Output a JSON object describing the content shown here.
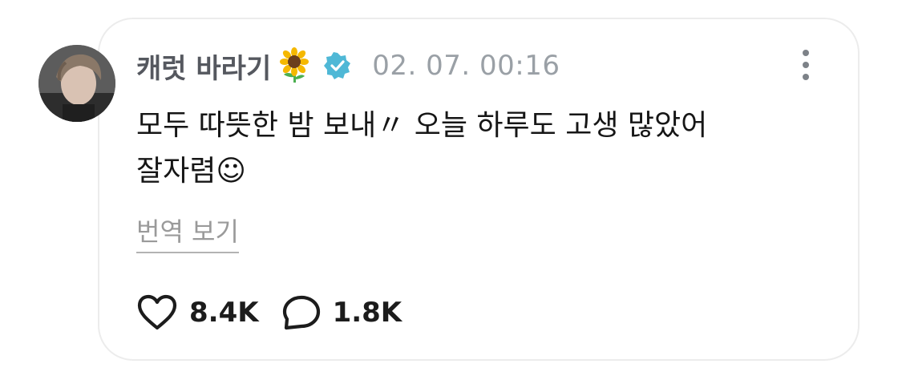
{
  "post": {
    "author_name": "캐럿 바라기",
    "author_emoji": "sunflower",
    "verified": true,
    "timestamp": "02. 07. 00:16",
    "text_line1": "모두 따뜻한 밤 보내〃 오늘 하루도 고생 많았어",
    "text_line2": "잘자렴☺",
    "translate_label": "번역 보기",
    "likes": "8.4K",
    "comments": "1.8K"
  },
  "icons": {
    "verified": "verified-check-icon",
    "more": "more-vertical-icon",
    "like": "heart-icon",
    "comment": "comment-bubble-icon"
  },
  "colors": {
    "verified_badge": "#4fb8d6",
    "name": "#55585f",
    "timestamp": "#9aa0a6",
    "body": "#161616",
    "translate": "#9a9a9a",
    "card_border": "#ececec"
  }
}
